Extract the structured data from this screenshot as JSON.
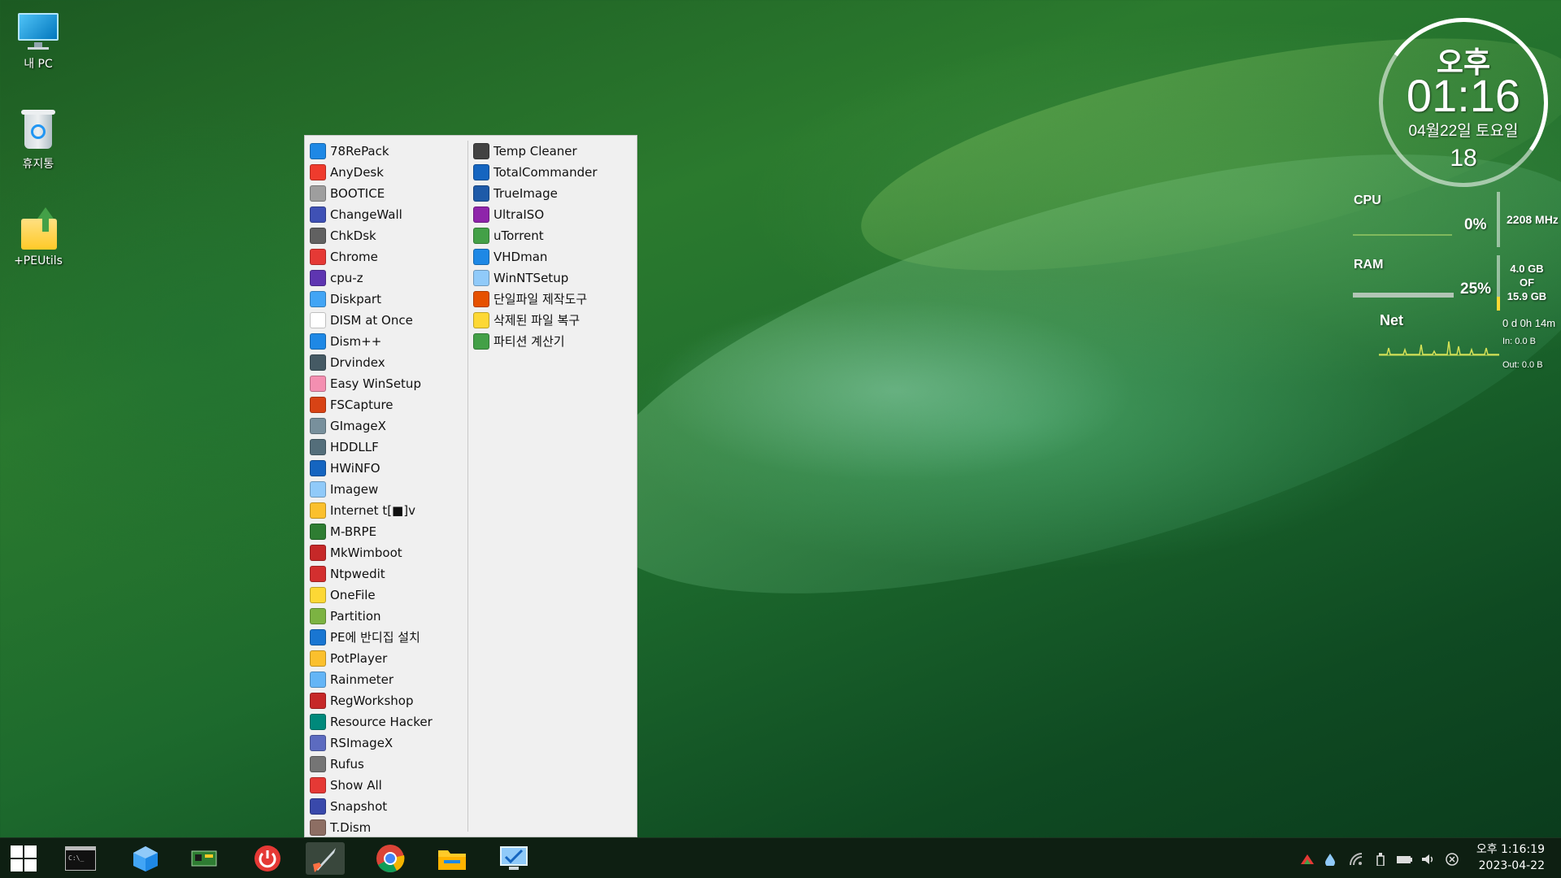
{
  "desktop": {
    "icons": [
      {
        "label": "내 PC",
        "icon": "monitor-icon"
      },
      {
        "label": "휴지통",
        "icon": "recycle-bin-icon"
      },
      {
        "label": "+PEUtils",
        "icon": "folder-icon"
      }
    ]
  },
  "start_menu": {
    "column1": [
      {
        "label": "78RePack",
        "color": "#1e88e5"
      },
      {
        "label": "AnyDesk",
        "color": "#ef3b2d"
      },
      {
        "label": "BOOTICE",
        "color": "#9e9e9e"
      },
      {
        "label": "ChangeWall",
        "color": "#3f51b5"
      },
      {
        "label": "ChkDsk",
        "color": "#616161"
      },
      {
        "label": "Chrome",
        "color": "#e53935"
      },
      {
        "label": "cpu-z",
        "color": "#5e35b1"
      },
      {
        "label": "Diskpart",
        "color": "#42a5f5"
      },
      {
        "label": "DISM at Once",
        "color": "#ffffff"
      },
      {
        "label": "Dism++",
        "color": "#1e88e5"
      },
      {
        "label": "Drvindex",
        "color": "#455a64"
      },
      {
        "label": "Easy WinSetup",
        "color": "#f48fb1"
      },
      {
        "label": "FSCapture",
        "color": "#d84315"
      },
      {
        "label": "GImageX",
        "color": "#78909c"
      },
      {
        "label": "HDDLLF",
        "color": "#546e7a"
      },
      {
        "label": "HWiNFO",
        "color": "#1565c0"
      },
      {
        "label": "Imagew",
        "color": "#90caf9"
      },
      {
        "label": "Internet t[■]v",
        "color": "#fbc02d"
      },
      {
        "label": "M-BRPE",
        "color": "#2e7d32"
      },
      {
        "label": "MkWimboot",
        "color": "#c62828"
      },
      {
        "label": "Ntpwedit",
        "color": "#d32f2f"
      },
      {
        "label": "OneFile",
        "color": "#fdd835"
      },
      {
        "label": "Partition",
        "color": "#7cb342"
      },
      {
        "label": "PE에 반디집 설치",
        "color": "#1976d2"
      },
      {
        "label": "PotPlayer",
        "color": "#fbc02d"
      },
      {
        "label": "Rainmeter",
        "color": "#64b5f6"
      },
      {
        "label": "RegWorkshop",
        "color": "#c62828"
      },
      {
        "label": "Resource Hacker",
        "color": "#00897b"
      },
      {
        "label": "RSImageX",
        "color": "#5c6bc0"
      },
      {
        "label": "Rufus",
        "color": "#757575"
      },
      {
        "label": "Show All",
        "color": "#e53935"
      },
      {
        "label": "Snapshot",
        "color": "#3949ab"
      },
      {
        "label": "T.Dism",
        "color": "#8d6e63"
      }
    ],
    "column2": [
      {
        "label": "Temp Cleaner",
        "color": "#424242"
      },
      {
        "label": "TotalCommander",
        "color": "#1565c0"
      },
      {
        "label": "TrueImage",
        "color": "#1e5aa8"
      },
      {
        "label": "UltraISO",
        "color": "#8e24aa"
      },
      {
        "label": "uTorrent",
        "color": "#43a047"
      },
      {
        "label": "VHDman",
        "color": "#1e88e5"
      },
      {
        "label": "WinNTSetup",
        "color": "#90caf9"
      },
      {
        "label": "단일파일 제작도구",
        "color": "#e65100"
      },
      {
        "label": "삭제된 파일 복구",
        "color": "#fdd835"
      },
      {
        "label": "파티션 계산기",
        "color": "#43a047"
      }
    ]
  },
  "clock_widget": {
    "ampm": "오후",
    "time": "01:16",
    "date": "04월22일 토요일",
    "seconds": "18"
  },
  "system_monitor": {
    "cpu": {
      "label": "CPU",
      "percent": "0%",
      "freq": "2208 MHz",
      "load_fraction": 0.0
    },
    "ram": {
      "label": "RAM",
      "percent": "25%",
      "used": "4.0 GB",
      "of": "OF",
      "total": "15.9 GB",
      "load_fraction": 0.25
    },
    "net": {
      "label": "Net",
      "uptime": "0 d 0h 14m",
      "in": "In: 0.0 B",
      "out": "Out: 0.0 B"
    }
  },
  "taskbar": {
    "buttons": [
      {
        "name": "start-button",
        "icon": "windows-logo-icon"
      },
      {
        "name": "cmd-button",
        "icon": "terminal-icon"
      },
      {
        "name": "cube-app-button",
        "icon": "cube-icon"
      },
      {
        "name": "hardware-button",
        "icon": "circuit-board-icon"
      },
      {
        "name": "power-button",
        "icon": "power-icon"
      },
      {
        "name": "launcher-button",
        "icon": "rocket-icon"
      },
      {
        "name": "chrome-button",
        "icon": "chrome-icon"
      },
      {
        "name": "explorer-button",
        "icon": "folder-icon"
      },
      {
        "name": "remote-desktop-button",
        "icon": "remote-desktop-icon"
      }
    ],
    "clock": {
      "time": "오후 1:16:19",
      "date": "2023-04-22"
    },
    "accent": "#3ddc84"
  }
}
